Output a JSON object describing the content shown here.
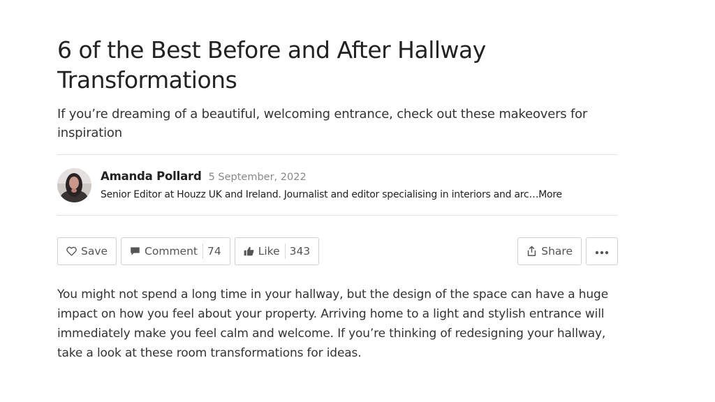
{
  "article": {
    "title": "6 of the Best Before and After Hallway Transformations",
    "subtitle": "If you’re dreaming of a beautiful, welcoming entrance, check out these makeovers for inspiration",
    "body": "You might not spend a long time in your hallway, but the design of the space can have a huge impact on how you feel about your property. Arriving home to a light and stylish entrance will immediately make you feel calm and welcome. If you’re thinking of redesigning your hallway, take a look at these room transformations for ideas."
  },
  "author": {
    "name": "Amanda Pollard",
    "date": "5 September, 2022",
    "bio": "Senior Editor at Houzz UK and Ireland. Journalist and editor specialising in interiors and arc…",
    "more_label": "More"
  },
  "toolbar": {
    "save_label": "Save",
    "comment_label": "Comment",
    "comment_count": "74",
    "like_label": "Like",
    "like_count": "343",
    "share_label": "Share",
    "more_icon": "ellipsis-icon"
  },
  "icons": {
    "save": "heart-outline-icon",
    "comment": "speech-bubble-icon",
    "like": "thumbs-up-icon",
    "share": "share-upload-icon"
  },
  "colors": {
    "text": "#222222",
    "muted": "#888888",
    "border": "#cfcfcf",
    "icon": "#555555"
  }
}
